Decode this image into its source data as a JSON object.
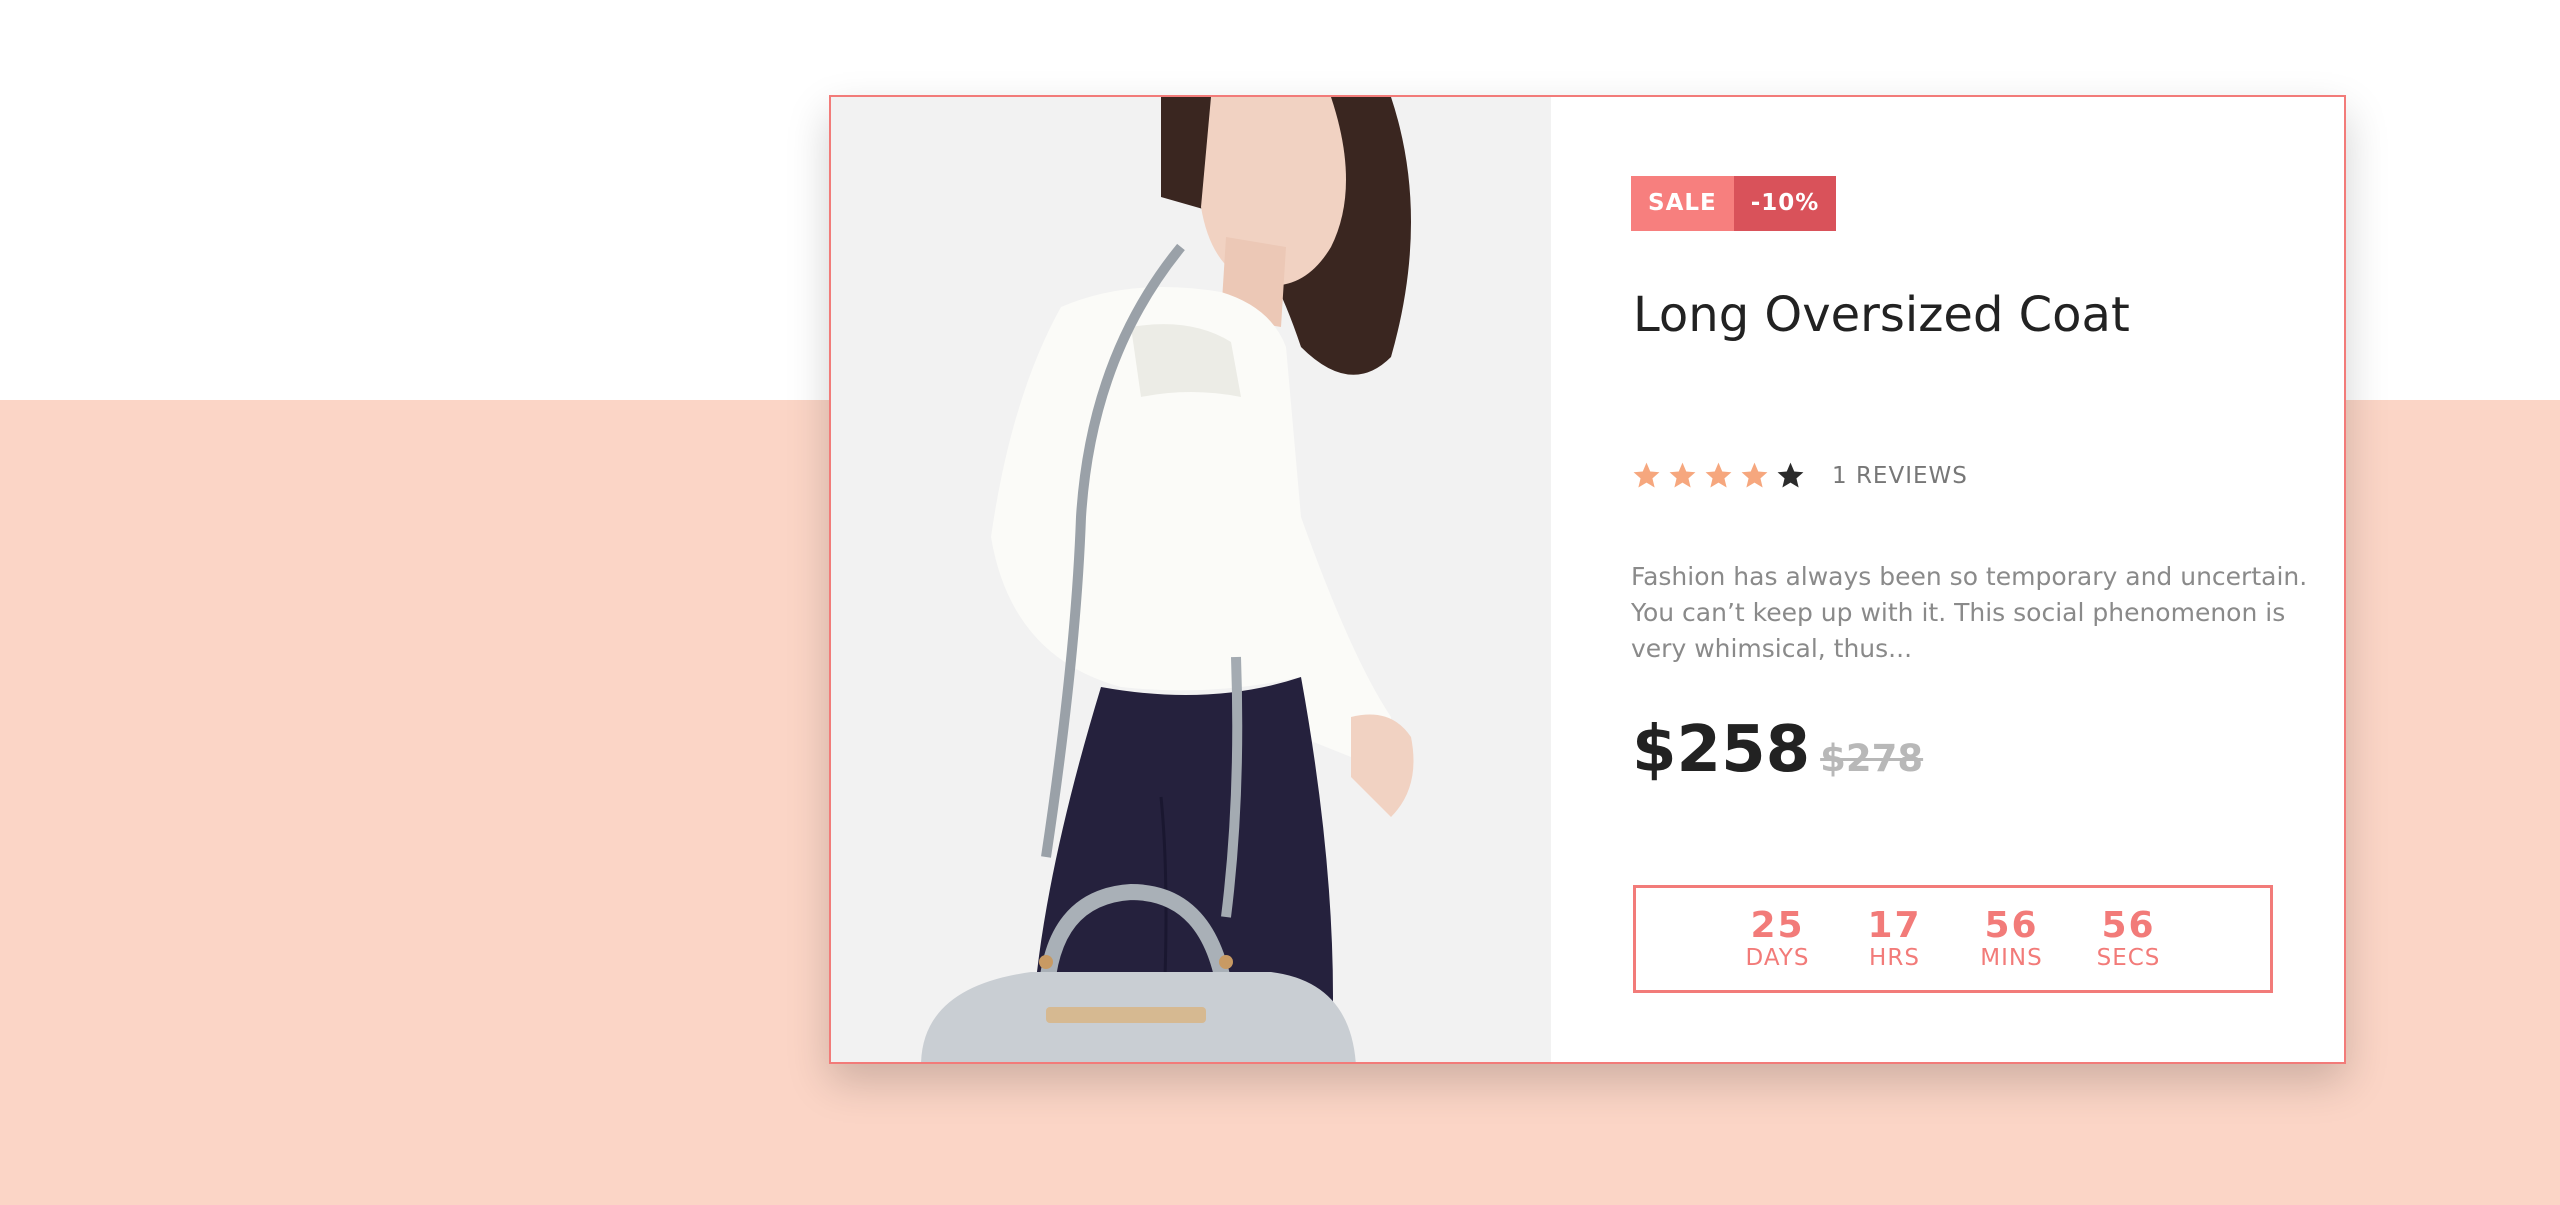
{
  "product": {
    "badge_sale": "SALE",
    "badge_discount": "-10%",
    "title": "Long Oversized Coat",
    "rating": 4,
    "rating_max": 5,
    "reviews": "1 REVIEWS",
    "description": "Fashion has always been so temporary and uncertain. You can’t keep up with it.  This social phenomenon is very whimsical, thus...",
    "price_current": "$258",
    "price_original": "$278"
  },
  "countdown": [
    {
      "value": "25",
      "label": "DAYS"
    },
    {
      "value": "17",
      "label": "HRS"
    },
    {
      "value": "56",
      "label": "MINS"
    },
    {
      "value": "56",
      "label": "SECS"
    }
  ],
  "colors": {
    "accent": "#f27b79",
    "sale_badge": "#f77f7e",
    "discount_badge": "#d9525a",
    "star_filled": "#f6a77e",
    "star_empty": "#2b2b2b",
    "band": "#fbd5c6"
  },
  "icons": {
    "star": "star-icon"
  }
}
